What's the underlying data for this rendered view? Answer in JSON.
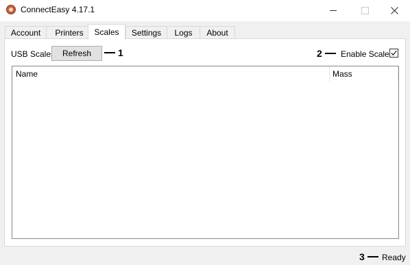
{
  "window": {
    "title": "ConnectEasy 4.17.1",
    "icon": "connecteasy-app-icon",
    "controls": [
      "minimize-icon",
      "maximize-icon",
      "close-icon"
    ]
  },
  "tabs": {
    "items": [
      {
        "label": "Account"
      },
      {
        "label": "Printers"
      },
      {
        "label": "Scales"
      },
      {
        "label": "Settings"
      },
      {
        "label": "Logs"
      },
      {
        "label": "About"
      }
    ],
    "active": "Scales"
  },
  "scales": {
    "usb_label": "USB Scales",
    "refresh_label": "Refresh",
    "enable_label": "Enable Scales",
    "enable_checked": true,
    "columns": [
      "Name",
      "Mass"
    ],
    "rows": []
  },
  "callouts": [
    "1",
    "2",
    "3"
  ],
  "status": {
    "text": "Ready"
  }
}
